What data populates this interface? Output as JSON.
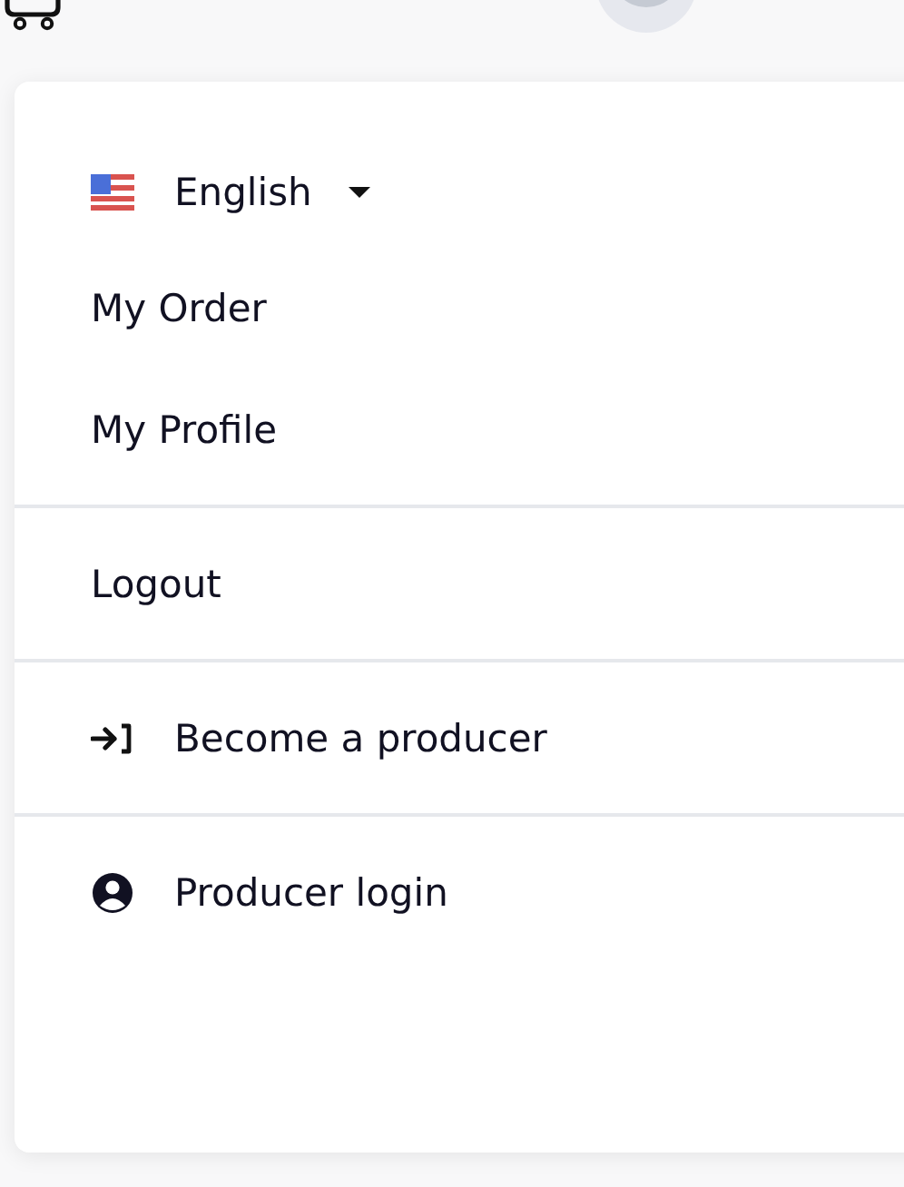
{
  "menu": {
    "language": {
      "label": "English"
    },
    "sections": [
      [
        {
          "label": "My Order",
          "kind": "link"
        },
        {
          "label": "My Profile",
          "kind": "link"
        }
      ],
      [
        {
          "label": "Logout",
          "kind": "link"
        }
      ],
      [
        {
          "label": "Become a producer",
          "kind": "signup"
        }
      ],
      [
        {
          "label": "Producer login",
          "kind": "account"
        }
      ]
    ]
  }
}
